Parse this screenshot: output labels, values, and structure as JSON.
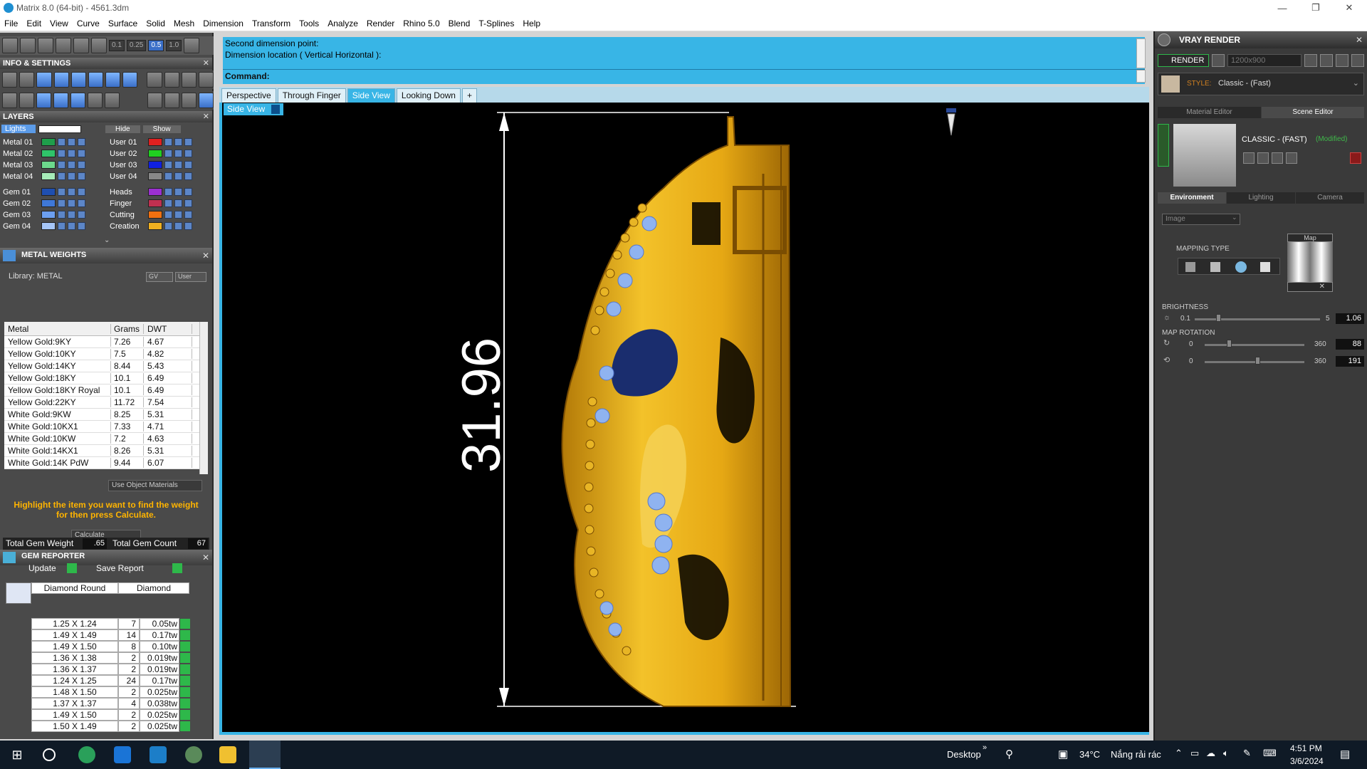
{
  "window": {
    "title": "Matrix 8.0 (64-bit) - 4561.3dm",
    "controls": [
      "—",
      "❐",
      "✕"
    ]
  },
  "menubar": [
    "File",
    "Edit",
    "View",
    "Curve",
    "Surface",
    "Solid",
    "Mesh",
    "Dimension",
    "Transform",
    "Tools",
    "Analyze",
    "Render",
    "Rhino 5.0",
    "Blend",
    "T-Splines",
    "Help"
  ],
  "toolbar": {
    "snap_values": [
      "0.1",
      "0.25",
      "0.5",
      "1.0"
    ]
  },
  "info_settings": {
    "title": "INFO & SETTINGS",
    "close": "✕"
  },
  "layers": {
    "title": "LAYERS",
    "close": "✕",
    "lights_label": "Lights",
    "hide_label": "Hide",
    "show_label": "Show",
    "left": [
      {
        "name": "Metal 01",
        "color": "#1f9e4b"
      },
      {
        "name": "Metal 02",
        "color": "#2fc46a"
      },
      {
        "name": "Metal 03",
        "color": "#6cd88c"
      },
      {
        "name": "Metal 04",
        "color": "#a6ecb8"
      },
      {
        "name": "Gem 01",
        "color": "#1f4fb0"
      },
      {
        "name": "Gem 02",
        "color": "#3f78d8"
      },
      {
        "name": "Gem 03",
        "color": "#6c9ff0"
      },
      {
        "name": "Gem 04",
        "color": "#a6c6f8"
      }
    ],
    "right": [
      {
        "name": "User 01",
        "color": "#e02020"
      },
      {
        "name": "User 02",
        "color": "#20d020"
      },
      {
        "name": "User 03",
        "color": "#1020e0"
      },
      {
        "name": "User 04",
        "color": "#888888"
      },
      {
        "name": "Heads",
        "color": "#9b30d0"
      },
      {
        "name": "Finger",
        "color": "#c03050"
      },
      {
        "name": "Cutting",
        "color": "#f07010"
      },
      {
        "name": "Creation",
        "color": "#f0b020"
      }
    ]
  },
  "metal_weights": {
    "title": "METAL WEIGHTS",
    "close": "✕",
    "library": "Library: METAL",
    "gv": "GV",
    "user": "User",
    "columns": [
      "Metal",
      "Grams",
      "DWT"
    ],
    "rows": [
      [
        "Yellow Gold:9KY",
        "7.26",
        "4.67"
      ],
      [
        "Yellow Gold:10KY",
        "7.5",
        "4.82"
      ],
      [
        "Yellow Gold:14KY",
        "8.44",
        "5.43"
      ],
      [
        "Yellow Gold:18KY",
        "10.1",
        "6.49"
      ],
      [
        "Yellow Gold:18KY Royal",
        "10.1",
        "6.49"
      ],
      [
        "Yellow Gold:22KY",
        "11.72",
        "7.54"
      ],
      [
        "White Gold:9KW",
        "8.25",
        "5.31"
      ],
      [
        "White Gold:10KX1",
        "7.33",
        "4.71"
      ],
      [
        "White Gold:10KW",
        "7.2",
        "4.63"
      ],
      [
        "White Gold:14KX1",
        "8.26",
        "5.31"
      ],
      [
        "White Gold:14K PdW",
        "9.44",
        "6.07"
      ]
    ],
    "use_object_materials": "Use Object Materials",
    "hint": "Highlight the item you want to find the weight for then press Calculate.",
    "calculate": "Calculate"
  },
  "gem_reporter": {
    "title": "GEM REPORTER",
    "close": "✕",
    "total_weight_label": "Total Gem Weight",
    "total_weight": ".65",
    "total_count_label": "Total Gem Count",
    "total_count": "67",
    "update": "Update",
    "save_report": "Save Report",
    "columns": [
      "Diamond Round",
      "Diamond"
    ],
    "rows": [
      [
        "1.25 X 1.24",
        "7",
        "0.05tw"
      ],
      [
        "1.49 X 1.49",
        "14",
        "0.17tw"
      ],
      [
        "1.49 X 1.50",
        "8",
        "0.10tw"
      ],
      [
        "1.36 X 1.38",
        "2",
        "0.019tw"
      ],
      [
        "1.36 X 1.37",
        "2",
        "0.019tw"
      ],
      [
        "1.24 X 1.25",
        "24",
        "0.17tw"
      ],
      [
        "1.48 X 1.50",
        "2",
        "0.025tw"
      ],
      [
        "1.37 X 1.37",
        "4",
        "0.038tw"
      ],
      [
        "1.49 X 1.50",
        "2",
        "0.025tw"
      ],
      [
        "1.50 X 1.49",
        "2",
        "0.025tw"
      ]
    ]
  },
  "command": {
    "line1": "Second dimension point:",
    "line2": "Dimension location ( Vertical  Horizontal ):",
    "prompt": "Command:",
    "value": ""
  },
  "viewport_tabs": [
    "Perspective",
    "Through Finger",
    "Side View",
    "Looking Down",
    "+"
  ],
  "active_tab_index": 2,
  "viewport": {
    "label": "Side View",
    "dimension_text": "31.96",
    "background": "#000000",
    "accent": "#38b5e6",
    "gold": "#f0b21a"
  },
  "vray": {
    "title": "VRAY RENDER",
    "close": "✕",
    "render_label": "RENDER",
    "resolution": "1200x900",
    "style_label": "STYLE:",
    "style_value": "Classic - (Fast)",
    "tabs": [
      "Material Editor",
      "Scene Editor"
    ],
    "scene_name": "CLASSIC - (FAST)",
    "scene_modified": "(Modified)",
    "env_tabs": [
      "Environment",
      "Lighting",
      "Camera"
    ],
    "env_type": "Image",
    "mapping_type": "MAPPING TYPE",
    "map_label": "Map",
    "brightness_label": "BRIGHTNESS",
    "brightness_min": "0.1",
    "brightness_max": "5",
    "brightness_value": "1.06",
    "brightness_level": 0.19,
    "rotation_label": "MAP ROTATION",
    "rot1_min": "0",
    "rot1_max": "360",
    "rot1_value": "88",
    "rot1_level": 0.24,
    "rot2_min": "0",
    "rot2_max": "360",
    "rot2_value": "191",
    "rot2_level": 0.53
  },
  "taskbar": {
    "desktop": "Desktop",
    "chevron": "»",
    "temperature": "34°C",
    "weather": "Nắng rải rác",
    "time": "4:51 PM",
    "date": "3/6/2024"
  }
}
